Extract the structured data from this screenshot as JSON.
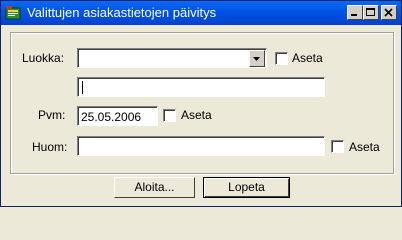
{
  "window": {
    "title": "Valittujen asiakastietojen päivitys"
  },
  "form": {
    "luokka_label": "Luokka:",
    "luokka_value": "",
    "luokka_aseta_label": "Aseta",
    "text_value": "",
    "pvm_label": "Pvm:",
    "pvm_value": "25.05.2006",
    "pvm_aseta_label": "Aseta",
    "huom_label": "Huom:",
    "huom_value": "",
    "huom_aseta_label": "Aseta"
  },
  "buttons": {
    "start_label": "Aloita...",
    "close_label": "Lopeta"
  },
  "icons": {
    "app": "app-icon",
    "minimize": "minimize-icon",
    "maximize": "maximize-icon",
    "close": "close-icon",
    "dropdown": "chevron-down-icon"
  }
}
